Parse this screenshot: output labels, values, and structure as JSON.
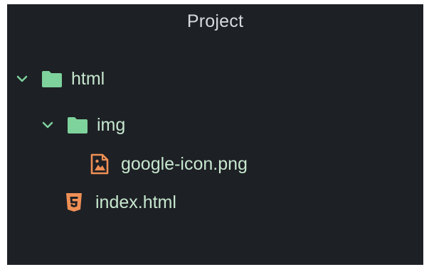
{
  "panel": {
    "title": "Project"
  },
  "tree": {
    "root": {
      "label": "html",
      "icon": "folder-icon",
      "expanded": true
    },
    "child_folder": {
      "label": "img",
      "icon": "folder-icon",
      "expanded": true
    },
    "file_in_img": {
      "label": "google-icon.png",
      "icon": "image-file-icon"
    },
    "file_in_root": {
      "label": "index.html",
      "icon": "html5-file-icon"
    }
  },
  "colors": {
    "background": "#1d2025",
    "text": "#c7e7cf",
    "folder": "#7ed29c",
    "file_orange": "#ef8f55"
  }
}
